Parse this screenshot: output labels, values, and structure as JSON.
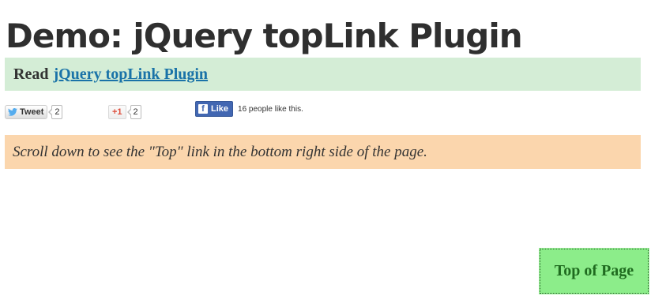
{
  "page": {
    "title": "Demo: jQuery topLink Plugin"
  },
  "read_bar": {
    "prefix": "Read",
    "link_text": "jQuery topLink Plugin",
    "background": "#d4edd6",
    "link_color": "#1a73a8"
  },
  "social": {
    "twitter": {
      "label": "Tweet",
      "count": "2",
      "icon": "twitter-bird-icon"
    },
    "google_plus": {
      "label": "+1",
      "count": "2"
    },
    "facebook": {
      "label": "Like",
      "icon": "facebook-f-icon",
      "icon_glyph": "f",
      "count_text": "16 people like this.",
      "color": "#4267b2"
    }
  },
  "notice": {
    "text": "Scroll down to see the \"Top\" link in the bottom right side of the page.",
    "background": "#fbd6ad"
  },
  "top_link": {
    "label": "Top of Page",
    "background": "#8ced8a",
    "color": "#1f6b1f"
  }
}
